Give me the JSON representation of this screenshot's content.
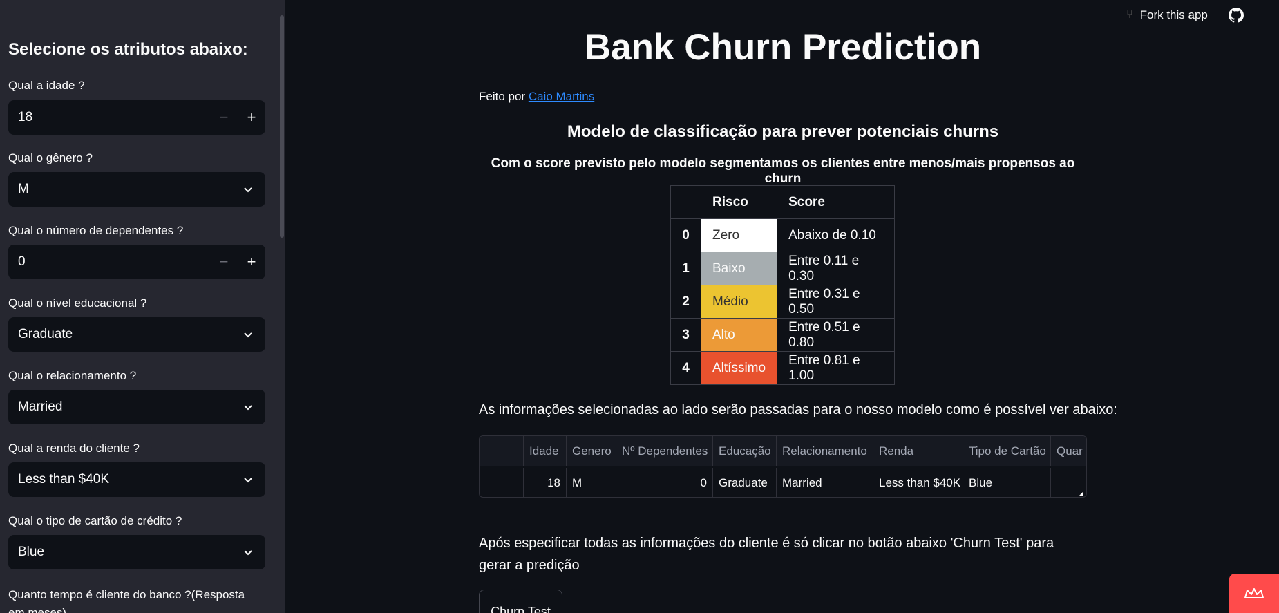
{
  "sidebar": {
    "heading": "Selecione os atributos abaixo:",
    "fields": [
      {
        "label": "Qual a idade ?",
        "value": "18",
        "kind": "stepper"
      },
      {
        "label": "Qual o gênero ?",
        "value": "M",
        "kind": "select"
      },
      {
        "label": "Qual o número de dependentes ?",
        "value": "0",
        "kind": "stepper"
      },
      {
        "label": "Qual o nível educacional ?",
        "value": "Graduate",
        "kind": "select"
      },
      {
        "label": "Qual o relacionamento ?",
        "value": "Married",
        "kind": "select"
      },
      {
        "label": "Qual a renda do cliente ?",
        "value": "Less than $40K",
        "kind": "select"
      },
      {
        "label": "Qual o tipo de cartão de crédito ?",
        "value": "Blue",
        "kind": "select"
      },
      {
        "label": "Quanto tempo é cliente do banco ?(Resposta em meses)",
        "kind": "stepper"
      }
    ],
    "stepper_minus": "−",
    "stepper_plus": "+"
  },
  "header": {
    "fork_label": "Fork this app",
    "fork_icon": "fork-icon",
    "github_icon": "github-icon"
  },
  "main": {
    "title": "Bank Churn Prediction",
    "byline_prefix": "Feito por",
    "author_link": "Caio Martins",
    "subtitle1": "Modelo de classificação para prever potenciais churns",
    "subtitle2": "Com o score previsto pelo modelo segmentamos os clientes entre menos/mais propensos ao churn",
    "risk_table": {
      "headers": [
        "",
        "Risco",
        "Score"
      ],
      "rows": [
        {
          "idx": "0",
          "risk": "Zero",
          "score": "Abaixo de 0.10",
          "color": "#ffffff",
          "text_color": "#333333"
        },
        {
          "idx": "1",
          "risk": "Baixo",
          "score": "Entre 0.11 e 0.30",
          "color": "#a6adb0",
          "text_color": "#fafafa"
        },
        {
          "idx": "2",
          "risk": "Médio",
          "score": "Entre 0.31 e 0.50",
          "color": "#ecc431",
          "text_color": "#333333"
        },
        {
          "idx": "3",
          "risk": "Alto",
          "score": "Entre 0.51 e 0.80",
          "color": "#ec9a37",
          "text_color": "#fafafa"
        },
        {
          "idx": "4",
          "risk": "Altíssimo",
          "score": "Entre 0.81 e 1.00",
          "color": "#e8522e",
          "text_color": "#fafafa"
        }
      ]
    },
    "info_text": "As informações selecionadas ao lado serão passadas para o nosso modelo como é possível ver abaixo:",
    "dataframe": {
      "columns": [
        "",
        "Idade",
        "Genero",
        "Nº Dependentes",
        "Educação",
        "Relacionamento",
        "Renda",
        "Tipo de Cartão",
        "Quar"
      ],
      "row": [
        "",
        "18",
        "M",
        "0",
        "Graduate",
        "Married",
        "Less than $40K",
        "Blue",
        ""
      ]
    },
    "after_text": "Após especificar todas as informações do cliente é só clicar no botão abaixo 'Churn Test' para gerar a predição",
    "button_label": "Churn Test"
  },
  "colors": {
    "accent": "#ff4b4b",
    "link": "#2e8bff",
    "background": "#0e1117",
    "sidebar": "#262730"
  }
}
